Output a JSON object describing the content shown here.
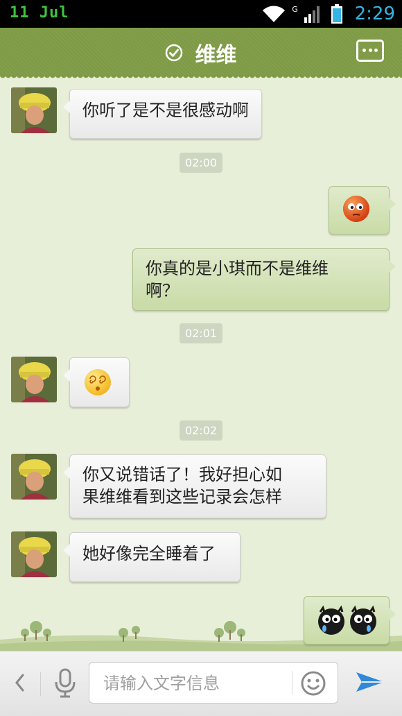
{
  "status_bar": {
    "left_text": "11  Jul",
    "time": "2:29",
    "network_label": "G",
    "icons": [
      "wifi-icon",
      "signal-icon",
      "battery-icon"
    ]
  },
  "header": {
    "title": "维维",
    "icons": [
      "verified-check-icon",
      "more-menu-icon"
    ]
  },
  "messages": [
    {
      "side": "in",
      "type": "text",
      "text": "你听了是不是很感动啊"
    },
    {
      "type": "time",
      "text": "02:00"
    },
    {
      "side": "out",
      "type": "emoji",
      "emoji": "blushing-face-icon"
    },
    {
      "side": "out",
      "type": "text",
      "text": "你真的是小琪而不是维维\n啊？"
    },
    {
      "type": "time",
      "text": "02:01"
    },
    {
      "side": "in",
      "type": "emoji",
      "emoji": "dizzy-face-icon"
    },
    {
      "type": "time",
      "text": "02:02"
    },
    {
      "side": "in",
      "type": "text",
      "text": "你又说错话了！我好担心如\n果维维看到这些记录会怎样"
    },
    {
      "side": "in",
      "type": "text",
      "text": "她好像完全睡着了"
    },
    {
      "side": "out",
      "type": "emoji",
      "emoji": "crying-creatures-icon"
    }
  ],
  "input_bar": {
    "placeholder": "请输入文字信息",
    "icons": [
      "chevron-left-icon",
      "microphone-icon",
      "smiley-icon",
      "send-icon"
    ]
  },
  "colors": {
    "header": "#7e9a45",
    "background": "#e8efd9",
    "outgoing_bubble": "#d2e1b3",
    "incoming_bubble": "#f2f2f2",
    "status_time": "#33b5e5",
    "status_date": "#3ec43e"
  }
}
